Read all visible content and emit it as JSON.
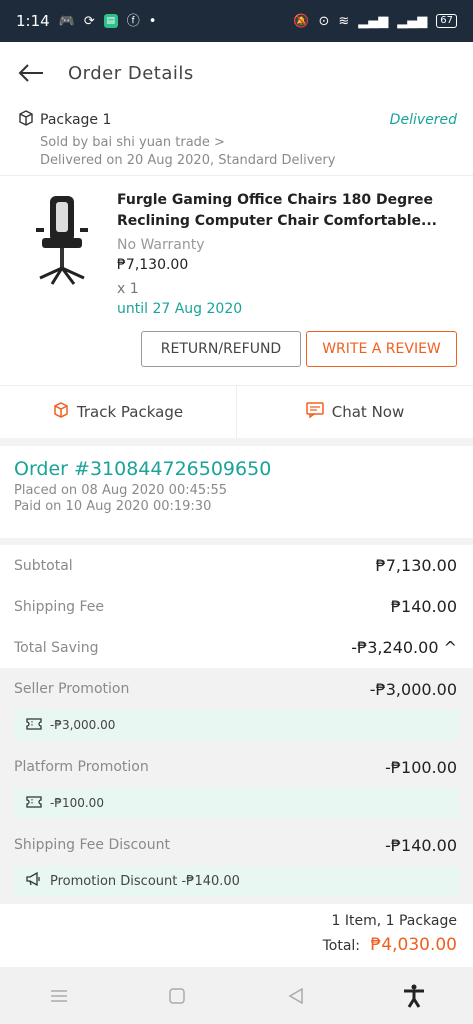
{
  "status_bar": {
    "time": "1:14",
    "battery": "67",
    "icons": [
      "gamepad-icon",
      "sync-icon",
      "app-icon",
      "facebook-icon",
      "dot-icon",
      "mute-icon",
      "location-icon",
      "wifi-icon",
      "signal-icon",
      "signal-icon-2",
      "battery-icon"
    ]
  },
  "header": {
    "title": "Order Details"
  },
  "package": {
    "title": "Package 1",
    "status": "Delivered",
    "seller": "Sold by bai shi yuan trade >",
    "delivery": "Delivered on 20 Aug 2020, Standard Delivery"
  },
  "item": {
    "name_line1": "Furgle Gaming Office Chairs 180 Degree",
    "name_line2": "Reclining Computer Chair Comfortable...",
    "warranty": "No Warranty",
    "price": "₱7,130.00",
    "quantity": "x 1",
    "until": "until  27 Aug 2020",
    "return_label": "RETURN/REFUND",
    "review_label": "WRITE A REVIEW"
  },
  "actions": {
    "track": "Track Package",
    "chat": "Chat Now"
  },
  "order": {
    "number": "Order #310844726509650",
    "placed": "Placed on 08 Aug 2020  00:45:55",
    "paid": "Paid on 10 Aug 2020  00:19:30"
  },
  "summary": {
    "subtotal_label": "Subtotal",
    "subtotal": "₱7,130.00",
    "shipping_label": "Shipping Fee",
    "shipping": "₱140.00",
    "saving_label": "Total Saving",
    "saving": "-₱3,240.00 ^",
    "seller_promo_label": "Seller Promotion",
    "seller_promo": "-₱3,000.00",
    "seller_chip": "-₱3,000.00",
    "platform_promo_label": "Platform Promotion",
    "platform_promo": "-₱100.00",
    "platform_chip": "-₱100.00",
    "ship_disc_label": "Shipping Fee Discount",
    "ship_disc": "-₱140.00",
    "ship_chip": "Promotion Discount -₱140.00"
  },
  "totals": {
    "count": "1 Item, 1 Package",
    "total_label": "Total:",
    "total": "₱4,030.00"
  },
  "colors": {
    "accent": "#1aa39a",
    "orange": "#f0601f",
    "status_bar": "#1e2b3a"
  }
}
